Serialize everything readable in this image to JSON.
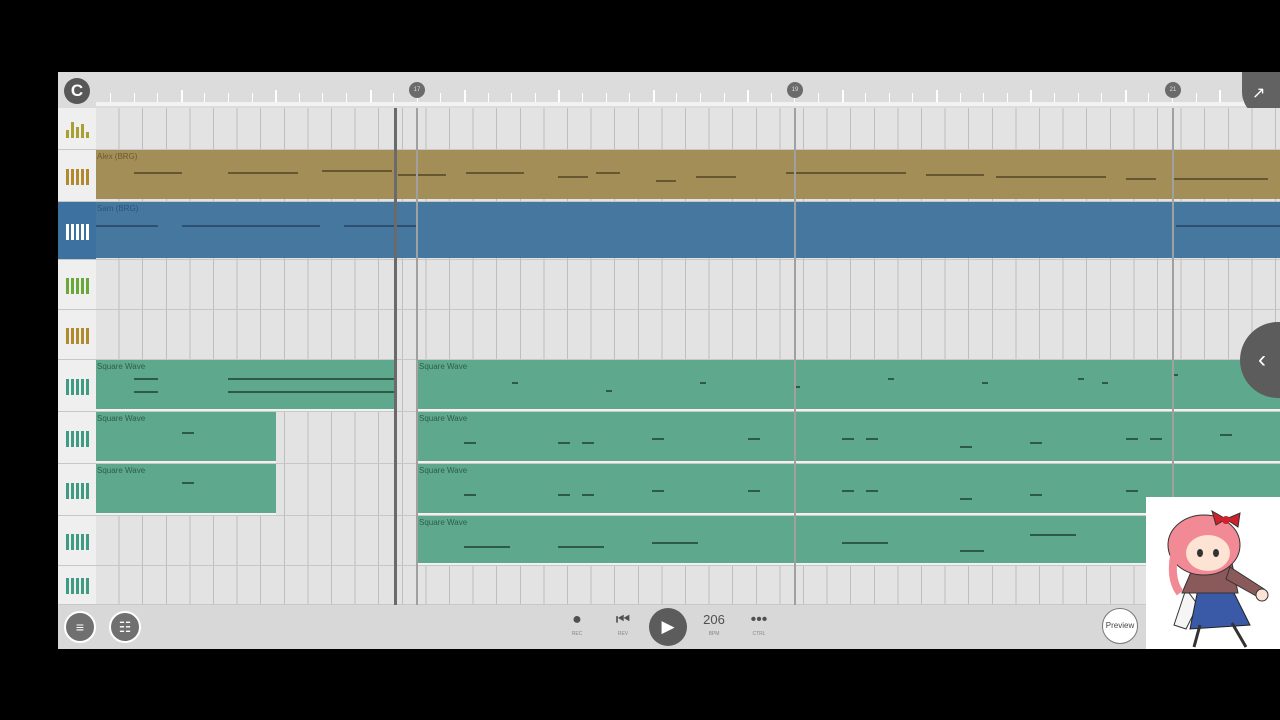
{
  "ruler": {
    "markers": [
      "17",
      "19",
      "21"
    ],
    "loop_icon": "C",
    "corner_icon": "↗"
  },
  "tracks": [
    {
      "name": "",
      "icon": "mixer-icon",
      "color": "#a9a033",
      "regions": []
    },
    {
      "name": "Alex (BRG)",
      "icon": "piano-icon",
      "color": "#a48e57",
      "regions": [
        {
          "label": "Alex (BRG)",
          "style": "gold"
        }
      ]
    },
    {
      "name": "Sam (BRG)",
      "icon": "piano-icon",
      "color": "#45779f",
      "selected": true,
      "regions": [
        {
          "label": "Sam (BRG)",
          "style": "blue"
        }
      ]
    },
    {
      "name": "",
      "icon": "piano-icon",
      "color": "#6aa83a",
      "regions": []
    },
    {
      "name": "",
      "icon": "piano-icon",
      "color": "#b08a2f",
      "regions": []
    },
    {
      "name": "",
      "icon": "piano-icon",
      "color": "#3f9c83",
      "regions": [
        {
          "label": "Square Wave"
        },
        {
          "label": "Square Wave"
        }
      ]
    },
    {
      "name": "",
      "icon": "piano-icon",
      "color": "#3f9c83",
      "regions": [
        {
          "label": "Square Wave"
        },
        {
          "label": "Square Wave"
        }
      ]
    },
    {
      "name": "",
      "icon": "piano-icon",
      "color": "#3f9c83",
      "regions": [
        {
          "label": "Square Wave"
        },
        {
          "label": "Square Wave"
        }
      ]
    },
    {
      "name": "",
      "icon": "piano-icon",
      "color": "#3f9c83",
      "regions": [
        {
          "label": "Square Wave"
        }
      ]
    },
    {
      "name": "",
      "icon": "piano-icon",
      "color": "#3f9c83",
      "regions": []
    }
  ],
  "transport": {
    "rec_label": "REC",
    "rev_label": "REV",
    "bpm_value": "206",
    "bpm_label": "BPM",
    "ctrl_label": "CTRL",
    "preview_label": "Preview"
  },
  "colors": {
    "teal": "#5ea88d",
    "gold": "#a48e57",
    "blue": "#45779f",
    "selected_header": "#3d72a0"
  }
}
